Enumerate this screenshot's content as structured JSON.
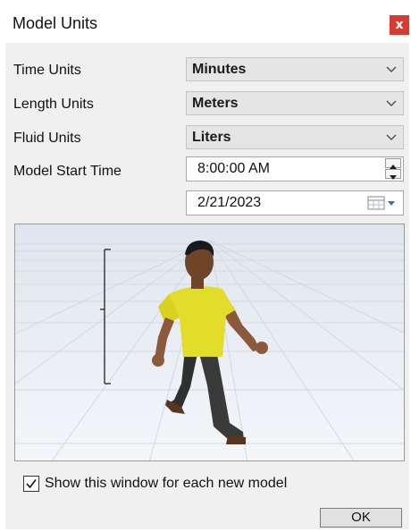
{
  "window": {
    "title": "Model Units",
    "close_glyph": "x"
  },
  "fields": {
    "time_units": {
      "label": "Time Units",
      "value": "Minutes"
    },
    "length_units": {
      "label": "Length Units",
      "value": "Meters"
    },
    "fluid_units": {
      "label": "Fluid Units",
      "value": "Liters"
    },
    "model_start_time": {
      "label": "Model Start Time",
      "time": "8:00:00 AM",
      "date": "2/21/2023"
    }
  },
  "preview": {
    "description_icon": "walking-person-figure",
    "scale_bar_icon": "scale-bracket"
  },
  "footer": {
    "show_window_label": "Show this window for each new model",
    "show_window_checked": true,
    "ok_label": "OK"
  },
  "colors": {
    "close_button": "#d83b34",
    "shirt": "#e2dc2a",
    "pants": "#3a3a3a",
    "dialog_bg": "#f0f0f0"
  }
}
